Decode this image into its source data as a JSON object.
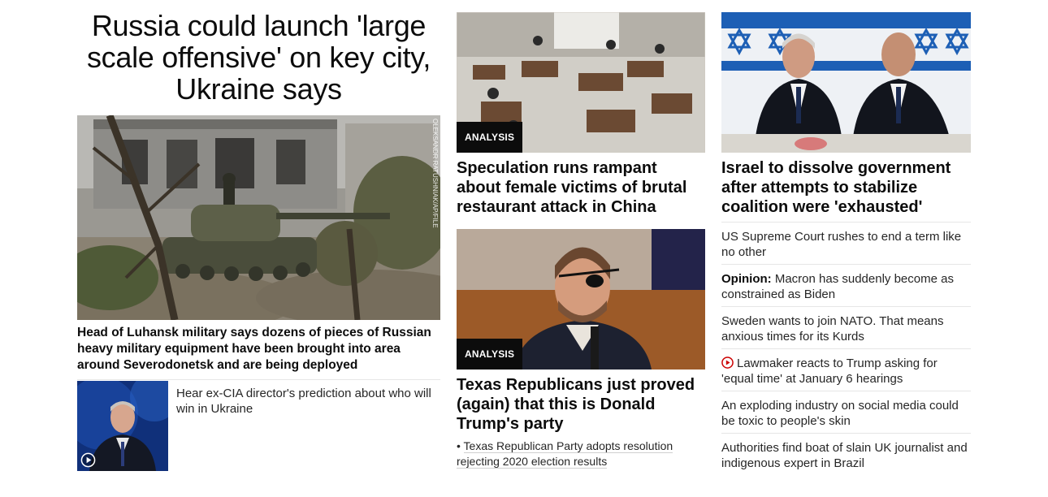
{
  "lead": {
    "headline": "Russia could launch 'large scale offensive' on key city, Ukraine says",
    "photo_credit": "OLEKSANDR RATUSHNIAK/AP/FILE",
    "description": "Head of Luhansk military says dozens of pieces of Russian heavy military equipment have been brought into area around Severodonetsk and are being deployed",
    "video_link": "Hear ex-CIA director's prediction about who will win in Ukraine",
    "icons": {
      "video": "play-circle-icon"
    }
  },
  "middle": {
    "card1": {
      "badge": "ANALYSIS",
      "title": "Speculation runs rampant about female victims of brutal restaurant attack in China"
    },
    "card2": {
      "badge": "ANALYSIS",
      "title": "Texas Republicans just proved (again) that this is Donald Trump's party",
      "related": "Texas Republican Party adopts resolution rejecting 2020 election results"
    }
  },
  "right": {
    "top_title": "Israel to dissolve government after attempts to stabilize coalition were 'exhausted'",
    "items": [
      {
        "prefix": "",
        "text": "US Supreme Court rushes to end a term like no other",
        "video": false
      },
      {
        "prefix": "Opinion:",
        "text": "Macron has suddenly become as constrained as Biden",
        "video": false
      },
      {
        "prefix": "",
        "text": "Sweden wants to join NATO. That means anxious times for its Kurds",
        "video": false
      },
      {
        "prefix": "",
        "text": "Lawmaker reacts to Trump asking for 'equal time' at January 6 hearings",
        "video": true
      },
      {
        "prefix": "",
        "text": "An exploding industry on social media could be toxic to people's skin",
        "video": false
      },
      {
        "prefix": "",
        "text": "Authorities find boat of slain UK journalist and indigenous expert in Brazil",
        "video": false
      }
    ]
  },
  "colors": {
    "text": "#0c0c0c",
    "badge_bg": "#0c0c0c",
    "video_red": "#cc0000",
    "divider": "#e6e6e6"
  }
}
